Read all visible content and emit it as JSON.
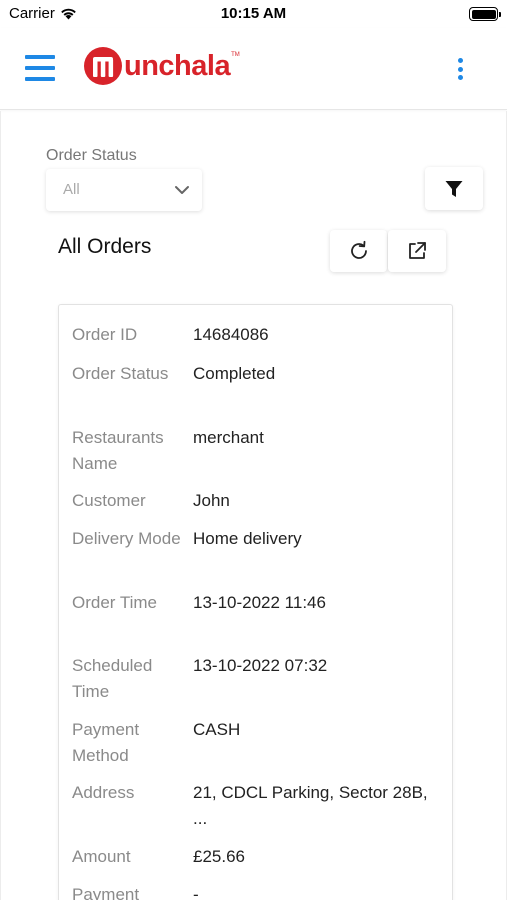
{
  "status_bar": {
    "carrier": "Carrier",
    "time": "10:15 AM"
  },
  "header": {
    "logo_text": "unchala",
    "logo_tm": "TM",
    "brand_color": "#d8232a",
    "accent_color": "#1e88e5"
  },
  "filters": {
    "order_status_label": "Order Status",
    "order_status_value": "All"
  },
  "page": {
    "title": "All Orders"
  },
  "order": {
    "rows": [
      {
        "key": "Order ID",
        "value": "14684086"
      },
      {
        "key": "Order Status",
        "value": "Completed"
      },
      {
        "key": "Restaurants Name",
        "value": "merchant"
      },
      {
        "key": "Customer",
        "value": "John"
      },
      {
        "key": "Delivery Mode",
        "value": "Home delivery"
      },
      {
        "key": "Order Time",
        "value": "13-10-2022 11:46"
      },
      {
        "key": "Scheduled Time",
        "value": "13-10-2022 07:32"
      },
      {
        "key": "Payment Method",
        "value": "CASH"
      },
      {
        "key": "Address",
        "value": "21, CDCL Parking, Sector 28B, ..."
      },
      {
        "key": "Amount",
        "value": "£25.66"
      },
      {
        "key": "Payment",
        "value": "-"
      }
    ]
  }
}
